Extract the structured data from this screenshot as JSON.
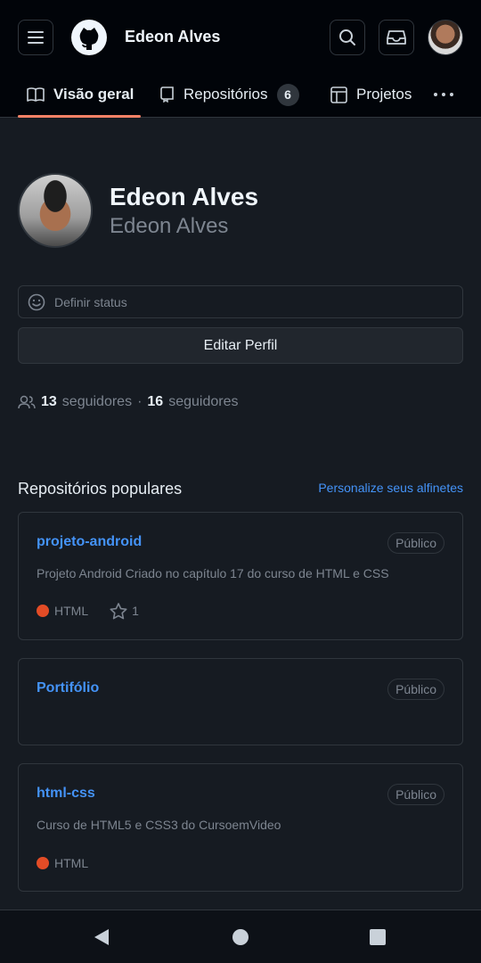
{
  "header": {
    "user_name": "Edeon Alves",
    "icons": {
      "menu": "menu-icon",
      "logo": "github-logo",
      "search": "search-icon",
      "inbox": "inbox-icon",
      "avatar": "avatar"
    }
  },
  "tabs": [
    {
      "label": "Visão geral",
      "icon": "book-icon",
      "active": true
    },
    {
      "label": "Repositórios",
      "icon": "repo-icon",
      "count": "6"
    },
    {
      "label": "Projetos",
      "icon": "table-icon"
    }
  ],
  "profile": {
    "name": "Edeon Alves",
    "login": "Edeon Alves",
    "status_placeholder": "Definir status",
    "edit_button": "Editar Perfil",
    "followers_count": "13",
    "followers_label": "seguidores",
    "following_count": "16",
    "following_label": "seguidores",
    "separator": "·"
  },
  "popular": {
    "title": "Repositórios populares",
    "customize_link": "Personalize seus alfinetes",
    "repos": [
      {
        "name": "projeto-android",
        "visibility": "Público",
        "description": "Projeto Android Criado no capítulo 17 do curso de HTML e CSS",
        "language": "HTML",
        "stars": "1"
      },
      {
        "name": "Portifólio",
        "visibility": "Público",
        "description": "",
        "language": "",
        "stars": ""
      },
      {
        "name": "html-css",
        "visibility": "Público",
        "description": "Curso de HTML5 e CSS3 do CursoemVideo",
        "language": "HTML",
        "stars": ""
      }
    ]
  },
  "colors": {
    "accent_tab": "#f78166",
    "link": "#4493f8",
    "html_lang": "#e34c26",
    "background": "#161b22",
    "header_bg": "#010409"
  }
}
